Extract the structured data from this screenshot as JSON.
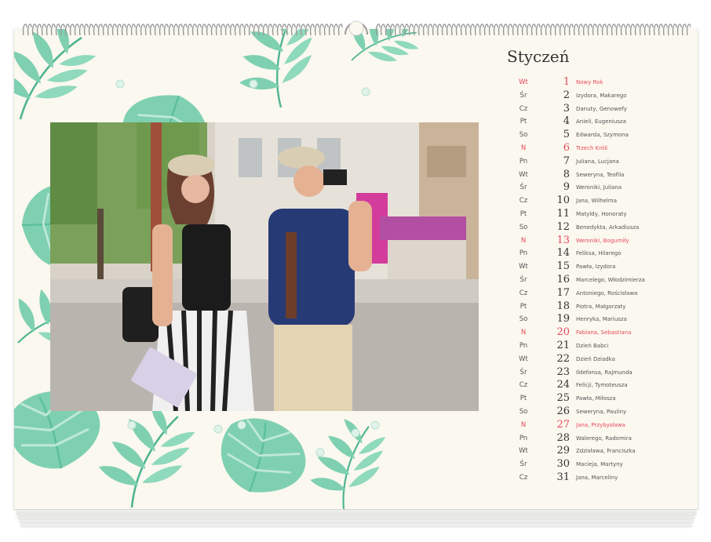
{
  "calendar": {
    "month": "Styczeń",
    "days": [
      {
        "weekday": "Wt",
        "day": "1",
        "names": "Nowy Rok",
        "holiday": true
      },
      {
        "weekday": "Śr",
        "day": "2",
        "names": "Izydora, Makarego",
        "holiday": false
      },
      {
        "weekday": "Cz",
        "day": "3",
        "names": "Danuty, Genowefy",
        "holiday": false
      },
      {
        "weekday": "Pt",
        "day": "4",
        "names": "Anieli, Eugeniusza",
        "holiday": false
      },
      {
        "weekday": "So",
        "day": "5",
        "names": "Edwarda, Szymona",
        "holiday": false
      },
      {
        "weekday": "N",
        "day": "6",
        "names": "Trzech Króli",
        "holiday": true
      },
      {
        "weekday": "Pn",
        "day": "7",
        "names": "Juliana, Lucjana",
        "holiday": false
      },
      {
        "weekday": "Wt",
        "day": "8",
        "names": "Seweryna, Teofila",
        "holiday": false
      },
      {
        "weekday": "Śr",
        "day": "9",
        "names": "Weroniki, Juliana",
        "holiday": false
      },
      {
        "weekday": "Cz",
        "day": "10",
        "names": "Jana, Wilhelma",
        "holiday": false
      },
      {
        "weekday": "Pt",
        "day": "11",
        "names": "Matyldy, Honoraty",
        "holiday": false
      },
      {
        "weekday": "So",
        "day": "12",
        "names": "Benedykta, Arkadiusza",
        "holiday": false
      },
      {
        "weekday": "N",
        "day": "13",
        "names": "Weroniki, Bogumiły",
        "holiday": true
      },
      {
        "weekday": "Pn",
        "day": "14",
        "names": "Feliksa, Hilarego",
        "holiday": false
      },
      {
        "weekday": "Wt",
        "day": "15",
        "names": "Pawła, Izydora",
        "holiday": false
      },
      {
        "weekday": "Śr",
        "day": "16",
        "names": "Marcelego, Włodzimierza",
        "holiday": false
      },
      {
        "weekday": "Cz",
        "day": "17",
        "names": "Antoniego, Rościsława",
        "holiday": false
      },
      {
        "weekday": "Pt",
        "day": "18",
        "names": "Piotra, Małgorzaty",
        "holiday": false
      },
      {
        "weekday": "So",
        "day": "19",
        "names": "Henryka, Mariusza",
        "holiday": false
      },
      {
        "weekday": "N",
        "day": "20",
        "names": "Fabiana, Sebastiana",
        "holiday": true
      },
      {
        "weekday": "Pn",
        "day": "21",
        "names": "Dzień Babci",
        "holiday": false
      },
      {
        "weekday": "Wt",
        "day": "22",
        "names": "Dzień Dziadka",
        "holiday": false
      },
      {
        "weekday": "Śr",
        "day": "23",
        "names": "Ildefonsa, Rajmunda",
        "holiday": false
      },
      {
        "weekday": "Cz",
        "day": "24",
        "names": "Felicji, Tymoteusza",
        "holiday": false
      },
      {
        "weekday": "Pt",
        "day": "25",
        "names": "Pawła, Miłosza",
        "holiday": false
      },
      {
        "weekday": "So",
        "day": "26",
        "names": "Seweryna, Pauliny",
        "holiday": false
      },
      {
        "weekday": "N",
        "day": "27",
        "names": "Jana, Przybysława",
        "holiday": true
      },
      {
        "weekday": "Pn",
        "day": "28",
        "names": "Walerego, Radomira",
        "holiday": false
      },
      {
        "weekday": "Wt",
        "day": "29",
        "names": "Zdzisława, Franciszka",
        "holiday": false
      },
      {
        "weekday": "Śr",
        "day": "30",
        "names": "Macieja, Martyny",
        "holiday": false
      },
      {
        "weekday": "Cz",
        "day": "31",
        "names": "Jana, Marceliny",
        "holiday": false
      }
    ]
  },
  "colors": {
    "paper": "#fbf8ef",
    "holiday": "#e64a5c",
    "leaf": "#7fd0b1",
    "leaf_dark": "#4fb592",
    "wire": "#9a9a9a"
  },
  "icons": [
    "monstera-leaf-icon",
    "palm-leaf-icon",
    "water-drop-icon",
    "spiral-binding-icon",
    "hanger-hook-icon"
  ]
}
